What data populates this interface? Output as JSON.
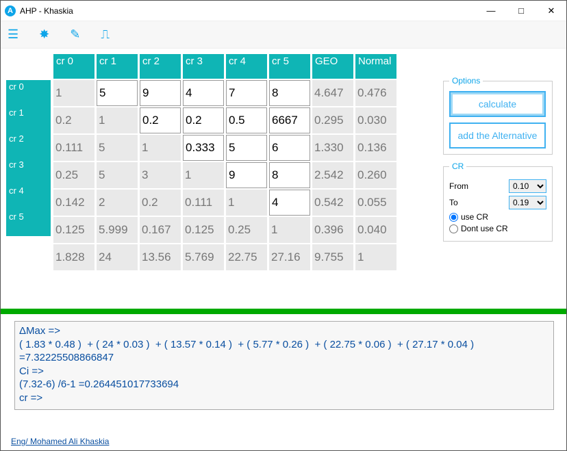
{
  "window": {
    "title": "AHP - Khaskia"
  },
  "columns": [
    "cr 0",
    "cr 1",
    "cr 2",
    "cr 3",
    "cr 4",
    "cr 5",
    "GEO",
    "Normal"
  ],
  "rowLabels": [
    "cr 0",
    "cr 1",
    "cr 2",
    "cr 3",
    "cr 4",
    "cr 5"
  ],
  "matrix": [
    [
      {
        "v": "1",
        "ro": true
      },
      {
        "v": "5",
        "ro": false
      },
      {
        "v": "9",
        "ro": false
      },
      {
        "v": "4",
        "ro": false
      },
      {
        "v": "7",
        "ro": false
      },
      {
        "v": "8",
        "ro": false
      },
      {
        "v": "4.647",
        "ro": true
      },
      {
        "v": "0.476",
        "ro": true
      }
    ],
    [
      {
        "v": "0.2",
        "ro": true
      },
      {
        "v": "1",
        "ro": true
      },
      {
        "v": "0.2",
        "ro": false
      },
      {
        "v": "0.2",
        "ro": false
      },
      {
        "v": "0.5",
        "ro": false
      },
      {
        "v": "6667",
        "ro": false
      },
      {
        "v": "0.295",
        "ro": true
      },
      {
        "v": "0.030",
        "ro": true
      }
    ],
    [
      {
        "v": "0.111",
        "ro": true
      },
      {
        "v": "5",
        "ro": true
      },
      {
        "v": "1",
        "ro": true
      },
      {
        "v": "0.333",
        "ro": false
      },
      {
        "v": "5",
        "ro": false
      },
      {
        "v": "6",
        "ro": false
      },
      {
        "v": "1.330",
        "ro": true
      },
      {
        "v": "0.136",
        "ro": true
      }
    ],
    [
      {
        "v": "0.25",
        "ro": true
      },
      {
        "v": "5",
        "ro": true
      },
      {
        "v": "3",
        "ro": true
      },
      {
        "v": "1",
        "ro": true
      },
      {
        "v": "9",
        "ro": false
      },
      {
        "v": "8",
        "ro": false
      },
      {
        "v": "2.542",
        "ro": true
      },
      {
        "v": "0.260",
        "ro": true
      }
    ],
    [
      {
        "v": "0.142",
        "ro": true
      },
      {
        "v": "2",
        "ro": true
      },
      {
        "v": "0.2",
        "ro": true
      },
      {
        "v": "0.111",
        "ro": true
      },
      {
        "v": "1",
        "ro": true
      },
      {
        "v": "4",
        "ro": false
      },
      {
        "v": "0.542",
        "ro": true
      },
      {
        "v": "0.055",
        "ro": true
      }
    ],
    [
      {
        "v": "0.125",
        "ro": true
      },
      {
        "v": "5.999",
        "ro": true
      },
      {
        "v": "0.167",
        "ro": true
      },
      {
        "v": "0.125",
        "ro": true
      },
      {
        "v": "0.25",
        "ro": true
      },
      {
        "v": "1",
        "ro": true
      },
      {
        "v": "0.396",
        "ro": true
      },
      {
        "v": "0.040",
        "ro": true
      }
    ],
    [
      {
        "v": "1.828",
        "ro": true
      },
      {
        "v": "24",
        "ro": true
      },
      {
        "v": "13.56",
        "ro": true
      },
      {
        "v": "5.769",
        "ro": true
      },
      {
        "v": "22.75",
        "ro": true
      },
      {
        "v": "27.16",
        "ro": true
      },
      {
        "v": "9.755",
        "ro": true
      },
      {
        "v": "1",
        "ro": true
      }
    ]
  ],
  "options": {
    "group": "Options",
    "calculate": "calculate",
    "addAlt": "add the Alternative"
  },
  "cr": {
    "group": "CR",
    "fromLabel": "From",
    "fromValue": "0.10",
    "toLabel": "To",
    "toValue": "0.19",
    "useCR": "use CR",
    "dontUseCR": "Dont use CR"
  },
  "output": "ΔMax =>\n( 1.83 * 0.48 )  + ( 24 * 0.03 )  + ( 13.57 * 0.14 )  + ( 5.77 * 0.26 )  + ( 22.75 * 0.06 )  + ( 27.17 * 0.04 )  =7.32225508866847\nCi =>\n(7.32-6) /6-1 =0.264451017733694\ncr =>",
  "footer": "Eng/ Mohamed Ali Khaskia"
}
